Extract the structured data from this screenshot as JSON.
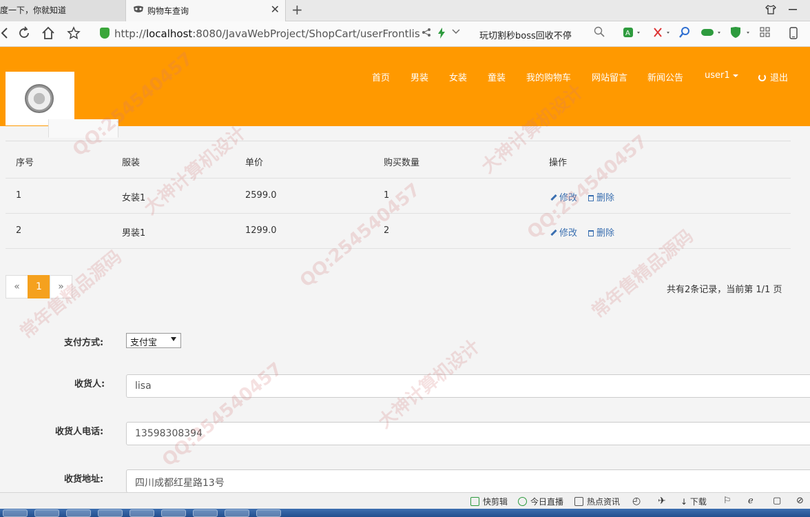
{
  "browser": {
    "tabs": [
      {
        "title": "度一下，你就知道"
      },
      {
        "title": "购物车查询"
      }
    ],
    "new_tab_symbol": "+",
    "close_symbol": "✕",
    "url": {
      "prefix": "http://",
      "host": "localhost",
      "rest": ":8080/JavaWebProject/ShopCart/userFrontlis"
    },
    "search_text": "玩切割秒boss回收不停"
  },
  "header": {
    "menu": [
      {
        "label": "首页"
      },
      {
        "label": "男装"
      },
      {
        "label": "女装"
      },
      {
        "label": "童装"
      },
      {
        "label": "我的购物车"
      },
      {
        "label": "网站留言"
      },
      {
        "label": "新闻公告"
      }
    ],
    "user_label": "user1",
    "logout_label": "退出",
    "accent_color": "#ff9900"
  },
  "table": {
    "columns": [
      "序号",
      "服装",
      "单价",
      "购买数量",
      "操作"
    ],
    "rows": [
      {
        "no": "1",
        "item": "女装1",
        "price": "2599.0",
        "qty": "1"
      },
      {
        "no": "2",
        "item": "男装1",
        "price": "1299.0",
        "qty": "2"
      }
    ],
    "edit_label": "修改",
    "delete_label": "删除"
  },
  "pagination": {
    "prev": "«",
    "current": "1",
    "next": "»",
    "info": "共有2条记录，当前第 1/1 页"
  },
  "form": {
    "payment_label": "支付方式:",
    "payment_value": "支付宝",
    "receiver_label": "收货人:",
    "receiver_value": "lisa",
    "phone_label": "收货人电话:",
    "phone_value": "13598308394",
    "address_label": "收货地址:",
    "address_value": "四川成都红星路13号"
  },
  "statusbar": {
    "items": [
      {
        "label": "快剪辑"
      },
      {
        "label": "今日直播"
      },
      {
        "label": "热点资讯"
      },
      {
        "label": "下载"
      }
    ]
  },
  "watermarks": [
    "QQ:254540457",
    "大神计算机设计",
    "常年售精品源码"
  ]
}
